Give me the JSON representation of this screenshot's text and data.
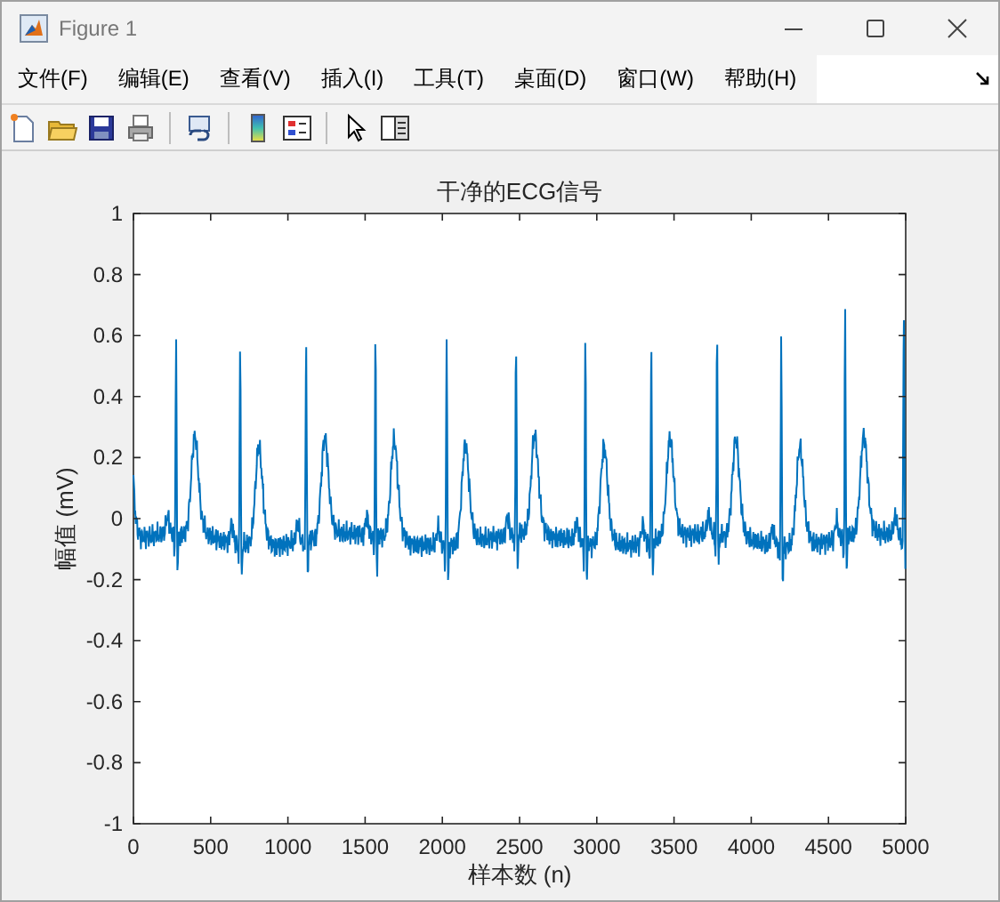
{
  "window": {
    "title": "Figure 1"
  },
  "menu": [
    {
      "label": "文件(F)"
    },
    {
      "label": "编辑(E)"
    },
    {
      "label": "查看(V)"
    },
    {
      "label": "插入(I)"
    },
    {
      "label": "工具(T)"
    },
    {
      "label": "桌面(D)"
    },
    {
      "label": "窗口(W)"
    },
    {
      "label": "帮助(H)"
    }
  ],
  "axes": {
    "title": "干净的ECG信号",
    "xlabel": "样本数 (n)",
    "ylabel": "幅值 (mV)",
    "xticks": [
      "0",
      "500",
      "1000",
      "1500",
      "2000",
      "2500",
      "3000",
      "3500",
      "4000",
      "4500",
      "5000"
    ],
    "yticks": [
      "1",
      "0.8",
      "0.6",
      "0.4",
      "0.2",
      "0",
      "-0.2",
      "-0.4",
      "-0.6",
      "-0.8",
      "-1"
    ]
  }
}
